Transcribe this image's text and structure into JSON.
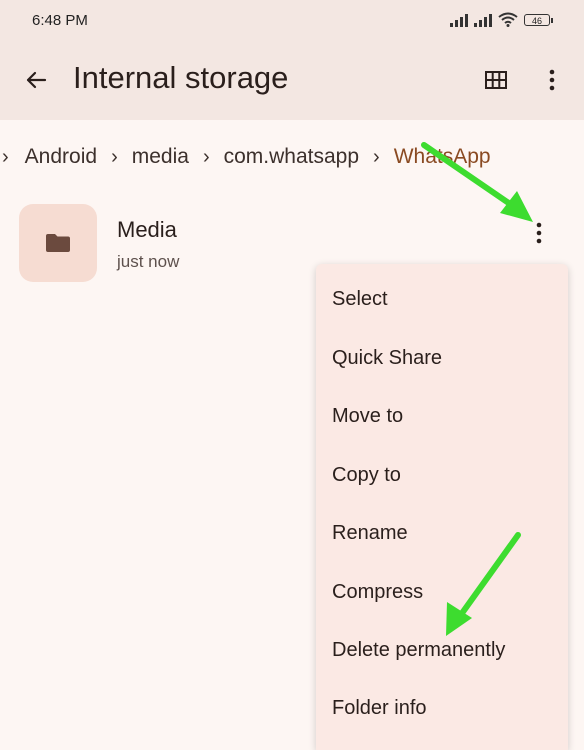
{
  "status_bar": {
    "time": "6:48 PM",
    "battery": "46"
  },
  "app_bar": {
    "title": "Internal storage"
  },
  "breadcrumbs": [
    "Android",
    "media",
    "com.whatsapp",
    "WhatsApp"
  ],
  "item": {
    "name": "Media",
    "modified": "just now"
  },
  "menu": {
    "items": [
      "Select",
      "Quick Share",
      "Move to",
      "Copy to",
      "Rename",
      "Compress",
      "Delete permanently",
      "Folder info"
    ]
  },
  "colors": {
    "annotation_arrow": "#3ddc2f",
    "accent_crumb": "#8a4a22"
  }
}
